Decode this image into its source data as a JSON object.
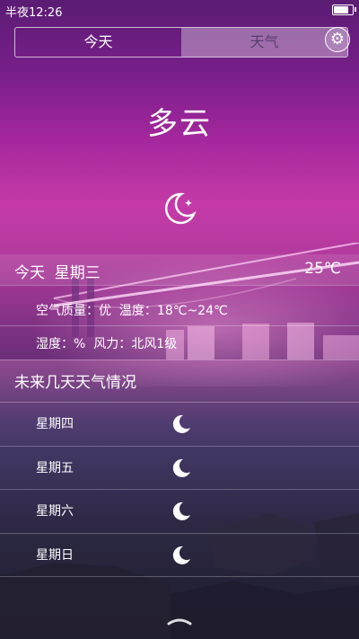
{
  "status": {
    "time": "半夜12:26"
  },
  "tabs": [
    {
      "label": "今天"
    },
    {
      "label": "天气"
    }
  ],
  "settings_icon": "gear-icon",
  "current": {
    "condition": "多云",
    "icon": "moon-icon",
    "day": "今天  星期三",
    "temp": "25℃",
    "air_quality": "空气质量：优",
    "temp_range": "温度：18℃~24℃",
    "humidity": "湿度：%",
    "wind": "风力：北风1级"
  },
  "forecast": {
    "title": "未来几天天气情况",
    "days": [
      {
        "day": "星期四",
        "icon": "moon-icon"
      },
      {
        "day": "星期五",
        "icon": "moon-icon"
      },
      {
        "day": "星期六",
        "icon": "moon-icon"
      },
      {
        "day": "星期日",
        "icon": "moon-icon"
      }
    ]
  },
  "pull_icon": "chevron-up-icon"
}
